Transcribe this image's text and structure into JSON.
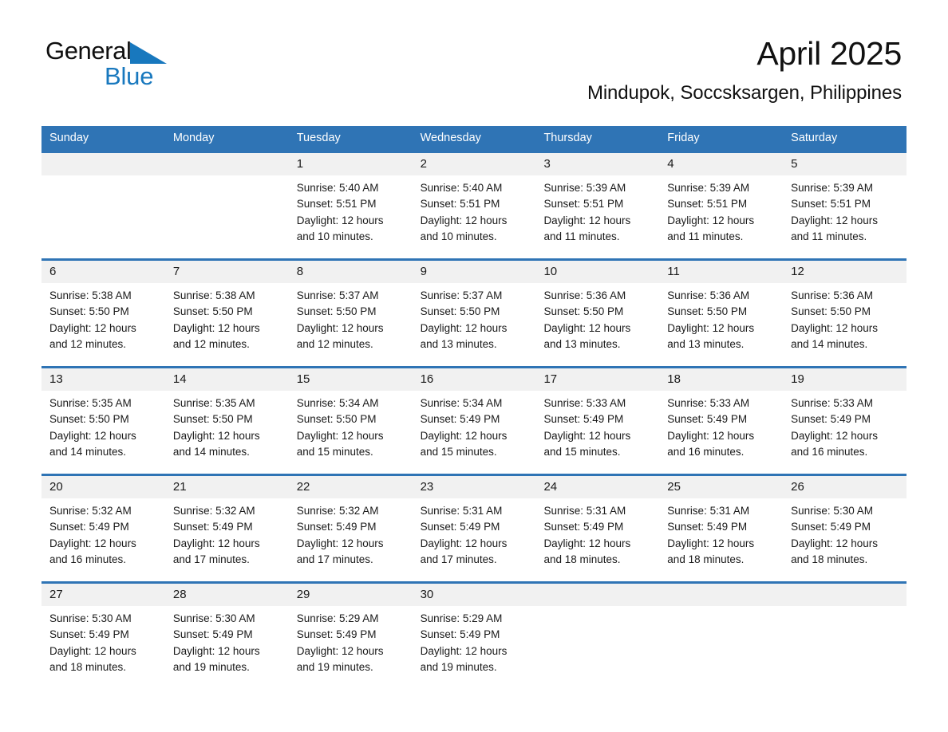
{
  "brand": {
    "name_part1": "General",
    "name_part2": "Blue",
    "flag_icon": "blue-triangle-logo-icon",
    "accent_color": "#1878be"
  },
  "header": {
    "title": "April 2025",
    "subtitle": "Mindupok, Soccsksargen, Philippines"
  },
  "colors": {
    "header_blue": "#2f74b5",
    "day_band_gray": "#f1f1f1",
    "text": "#1a1a1a"
  },
  "weekdays": [
    "Sunday",
    "Monday",
    "Tuesday",
    "Wednesday",
    "Thursday",
    "Friday",
    "Saturday"
  ],
  "weeks": [
    [
      {
        "day": "",
        "lines": []
      },
      {
        "day": "",
        "lines": []
      },
      {
        "day": "1",
        "lines": [
          "Sunrise: 5:40 AM",
          "Sunset: 5:51 PM",
          "Daylight: 12 hours",
          "and 10 minutes."
        ]
      },
      {
        "day": "2",
        "lines": [
          "Sunrise: 5:40 AM",
          "Sunset: 5:51 PM",
          "Daylight: 12 hours",
          "and 10 minutes."
        ]
      },
      {
        "day": "3",
        "lines": [
          "Sunrise: 5:39 AM",
          "Sunset: 5:51 PM",
          "Daylight: 12 hours",
          "and 11 minutes."
        ]
      },
      {
        "day": "4",
        "lines": [
          "Sunrise: 5:39 AM",
          "Sunset: 5:51 PM",
          "Daylight: 12 hours",
          "and 11 minutes."
        ]
      },
      {
        "day": "5",
        "lines": [
          "Sunrise: 5:39 AM",
          "Sunset: 5:51 PM",
          "Daylight: 12 hours",
          "and 11 minutes."
        ]
      }
    ],
    [
      {
        "day": "6",
        "lines": [
          "Sunrise: 5:38 AM",
          "Sunset: 5:50 PM",
          "Daylight: 12 hours",
          "and 12 minutes."
        ]
      },
      {
        "day": "7",
        "lines": [
          "Sunrise: 5:38 AM",
          "Sunset: 5:50 PM",
          "Daylight: 12 hours",
          "and 12 minutes."
        ]
      },
      {
        "day": "8",
        "lines": [
          "Sunrise: 5:37 AM",
          "Sunset: 5:50 PM",
          "Daylight: 12 hours",
          "and 12 minutes."
        ]
      },
      {
        "day": "9",
        "lines": [
          "Sunrise: 5:37 AM",
          "Sunset: 5:50 PM",
          "Daylight: 12 hours",
          "and 13 minutes."
        ]
      },
      {
        "day": "10",
        "lines": [
          "Sunrise: 5:36 AM",
          "Sunset: 5:50 PM",
          "Daylight: 12 hours",
          "and 13 minutes."
        ]
      },
      {
        "day": "11",
        "lines": [
          "Sunrise: 5:36 AM",
          "Sunset: 5:50 PM",
          "Daylight: 12 hours",
          "and 13 minutes."
        ]
      },
      {
        "day": "12",
        "lines": [
          "Sunrise: 5:36 AM",
          "Sunset: 5:50 PM",
          "Daylight: 12 hours",
          "and 14 minutes."
        ]
      }
    ],
    [
      {
        "day": "13",
        "lines": [
          "Sunrise: 5:35 AM",
          "Sunset: 5:50 PM",
          "Daylight: 12 hours",
          "and 14 minutes."
        ]
      },
      {
        "day": "14",
        "lines": [
          "Sunrise: 5:35 AM",
          "Sunset: 5:50 PM",
          "Daylight: 12 hours",
          "and 14 minutes."
        ]
      },
      {
        "day": "15",
        "lines": [
          "Sunrise: 5:34 AM",
          "Sunset: 5:50 PM",
          "Daylight: 12 hours",
          "and 15 minutes."
        ]
      },
      {
        "day": "16",
        "lines": [
          "Sunrise: 5:34 AM",
          "Sunset: 5:49 PM",
          "Daylight: 12 hours",
          "and 15 minutes."
        ]
      },
      {
        "day": "17",
        "lines": [
          "Sunrise: 5:33 AM",
          "Sunset: 5:49 PM",
          "Daylight: 12 hours",
          "and 15 minutes."
        ]
      },
      {
        "day": "18",
        "lines": [
          "Sunrise: 5:33 AM",
          "Sunset: 5:49 PM",
          "Daylight: 12 hours",
          "and 16 minutes."
        ]
      },
      {
        "day": "19",
        "lines": [
          "Sunrise: 5:33 AM",
          "Sunset: 5:49 PM",
          "Daylight: 12 hours",
          "and 16 minutes."
        ]
      }
    ],
    [
      {
        "day": "20",
        "lines": [
          "Sunrise: 5:32 AM",
          "Sunset: 5:49 PM",
          "Daylight: 12 hours",
          "and 16 minutes."
        ]
      },
      {
        "day": "21",
        "lines": [
          "Sunrise: 5:32 AM",
          "Sunset: 5:49 PM",
          "Daylight: 12 hours",
          "and 17 minutes."
        ]
      },
      {
        "day": "22",
        "lines": [
          "Sunrise: 5:32 AM",
          "Sunset: 5:49 PM",
          "Daylight: 12 hours",
          "and 17 minutes."
        ]
      },
      {
        "day": "23",
        "lines": [
          "Sunrise: 5:31 AM",
          "Sunset: 5:49 PM",
          "Daylight: 12 hours",
          "and 17 minutes."
        ]
      },
      {
        "day": "24",
        "lines": [
          "Sunrise: 5:31 AM",
          "Sunset: 5:49 PM",
          "Daylight: 12 hours",
          "and 18 minutes."
        ]
      },
      {
        "day": "25",
        "lines": [
          "Sunrise: 5:31 AM",
          "Sunset: 5:49 PM",
          "Daylight: 12 hours",
          "and 18 minutes."
        ]
      },
      {
        "day": "26",
        "lines": [
          "Sunrise: 5:30 AM",
          "Sunset: 5:49 PM",
          "Daylight: 12 hours",
          "and 18 minutes."
        ]
      }
    ],
    [
      {
        "day": "27",
        "lines": [
          "Sunrise: 5:30 AM",
          "Sunset: 5:49 PM",
          "Daylight: 12 hours",
          "and 18 minutes."
        ]
      },
      {
        "day": "28",
        "lines": [
          "Sunrise: 5:30 AM",
          "Sunset: 5:49 PM",
          "Daylight: 12 hours",
          "and 19 minutes."
        ]
      },
      {
        "day": "29",
        "lines": [
          "Sunrise: 5:29 AM",
          "Sunset: 5:49 PM",
          "Daylight: 12 hours",
          "and 19 minutes."
        ]
      },
      {
        "day": "30",
        "lines": [
          "Sunrise: 5:29 AM",
          "Sunset: 5:49 PM",
          "Daylight: 12 hours",
          "and 19 minutes."
        ]
      },
      {
        "day": "",
        "lines": []
      },
      {
        "day": "",
        "lines": []
      },
      {
        "day": "",
        "lines": []
      }
    ]
  ]
}
